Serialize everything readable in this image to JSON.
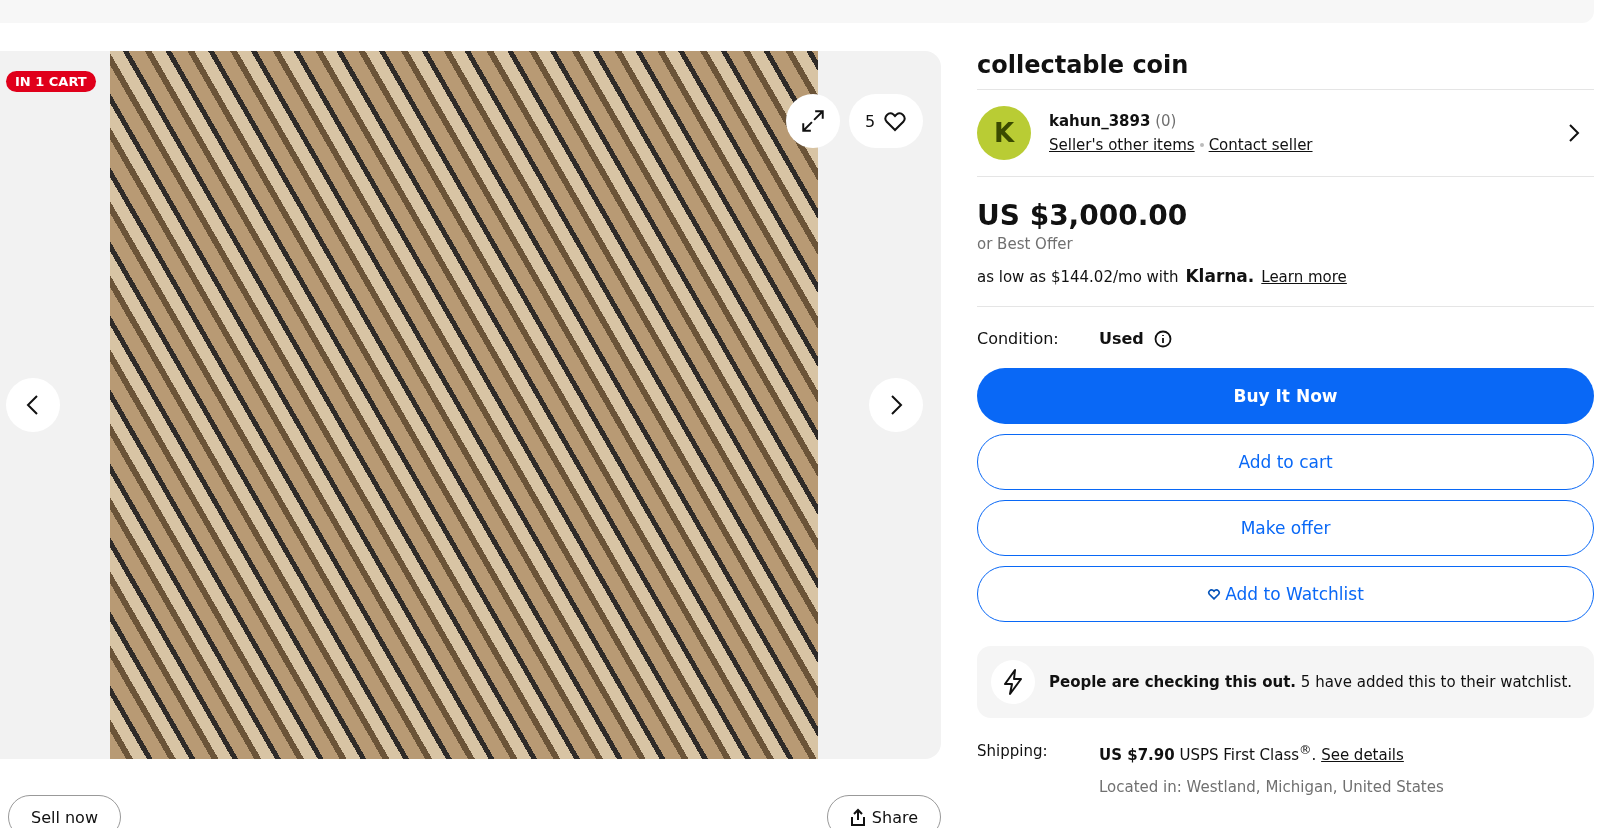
{
  "gallery": {
    "badge": "IN 1 CART",
    "watch_count": "5"
  },
  "bottom_buttons": {
    "sell": "Sell now",
    "share": "Share"
  },
  "title": "collectable coin",
  "seller": {
    "initial": "K",
    "name": "kahun_3893",
    "feedback": "(0)",
    "other_items": "Seller's other items",
    "contact": "Contact seller"
  },
  "price": {
    "amount": "US $3,000.00",
    "best_offer": "or Best Offer",
    "financing": "as low as $144.02/mo with",
    "klarna": "Klarna.",
    "learn_more": "Learn more"
  },
  "condition": {
    "label": "Condition:",
    "value": "Used"
  },
  "buttons": [
    {
      "kind": "primary",
      "label": "Buy It Now"
    },
    {
      "kind": "outline",
      "label": "Add to cart"
    },
    {
      "kind": "outline",
      "label": "Make offer"
    },
    {
      "kind": "watch",
      "label": "Add to Watchlist"
    }
  ],
  "notice": {
    "text": "**People are checking this out.** 5 have added this to their watchlist."
  },
  "shipping": {
    "label": "Shipping:",
    "text": "**US $7.90** USPS First Class$^{®}$.",
    "link": "See details",
    "location": "Located in: Westland, Michigan, United States"
  }
}
